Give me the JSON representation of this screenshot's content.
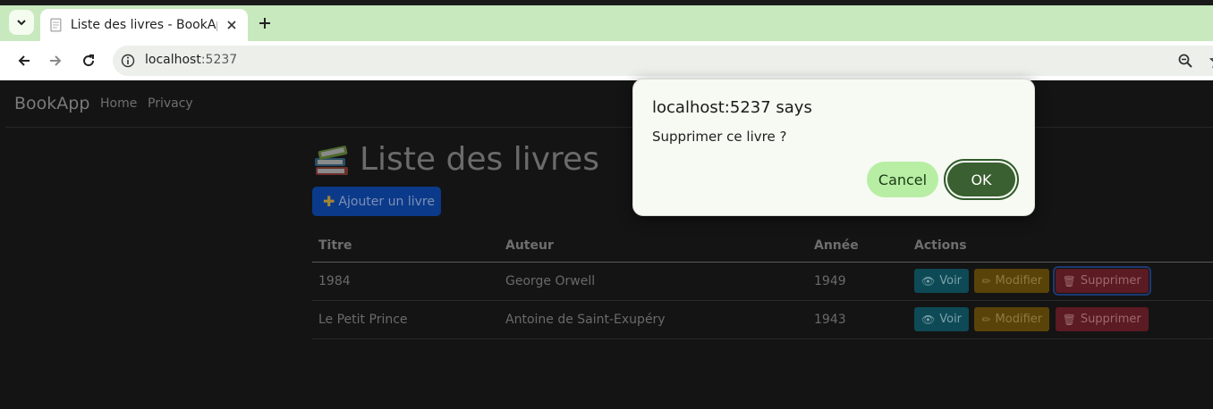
{
  "browser": {
    "tab_title": "Liste des livres - BookApp",
    "url_host": "localhost",
    "url_port": ":5237"
  },
  "navbar": {
    "brand": "BookApp",
    "links": [
      "Home",
      "Privacy"
    ]
  },
  "main": {
    "title": "Liste des livres",
    "add_button": "Ajouter un livre",
    "table": {
      "headers": [
        "Titre",
        "Auteur",
        "Année",
        "Actions"
      ],
      "rows": [
        {
          "titre": "1984",
          "auteur": "George Orwell",
          "annee": "1949"
        },
        {
          "titre": "Le Petit Prince",
          "auteur": "Antoine de Saint-Exupéry",
          "annee": "1943"
        }
      ],
      "actions": {
        "view": "Voir",
        "edit": "Modifier",
        "delete": "Supprimer"
      }
    }
  },
  "dialog": {
    "title": "localhost:5237 says",
    "message": "Supprimer ce livre ?",
    "cancel_label": "Cancel",
    "ok_label": "OK"
  },
  "colors": {
    "tabstrip": "#c8e8bd",
    "page_bg": "#141414",
    "dialog_bg": "#f6faf2",
    "ok_button": "#3a5f30",
    "cancel_button": "#b8eea4"
  }
}
